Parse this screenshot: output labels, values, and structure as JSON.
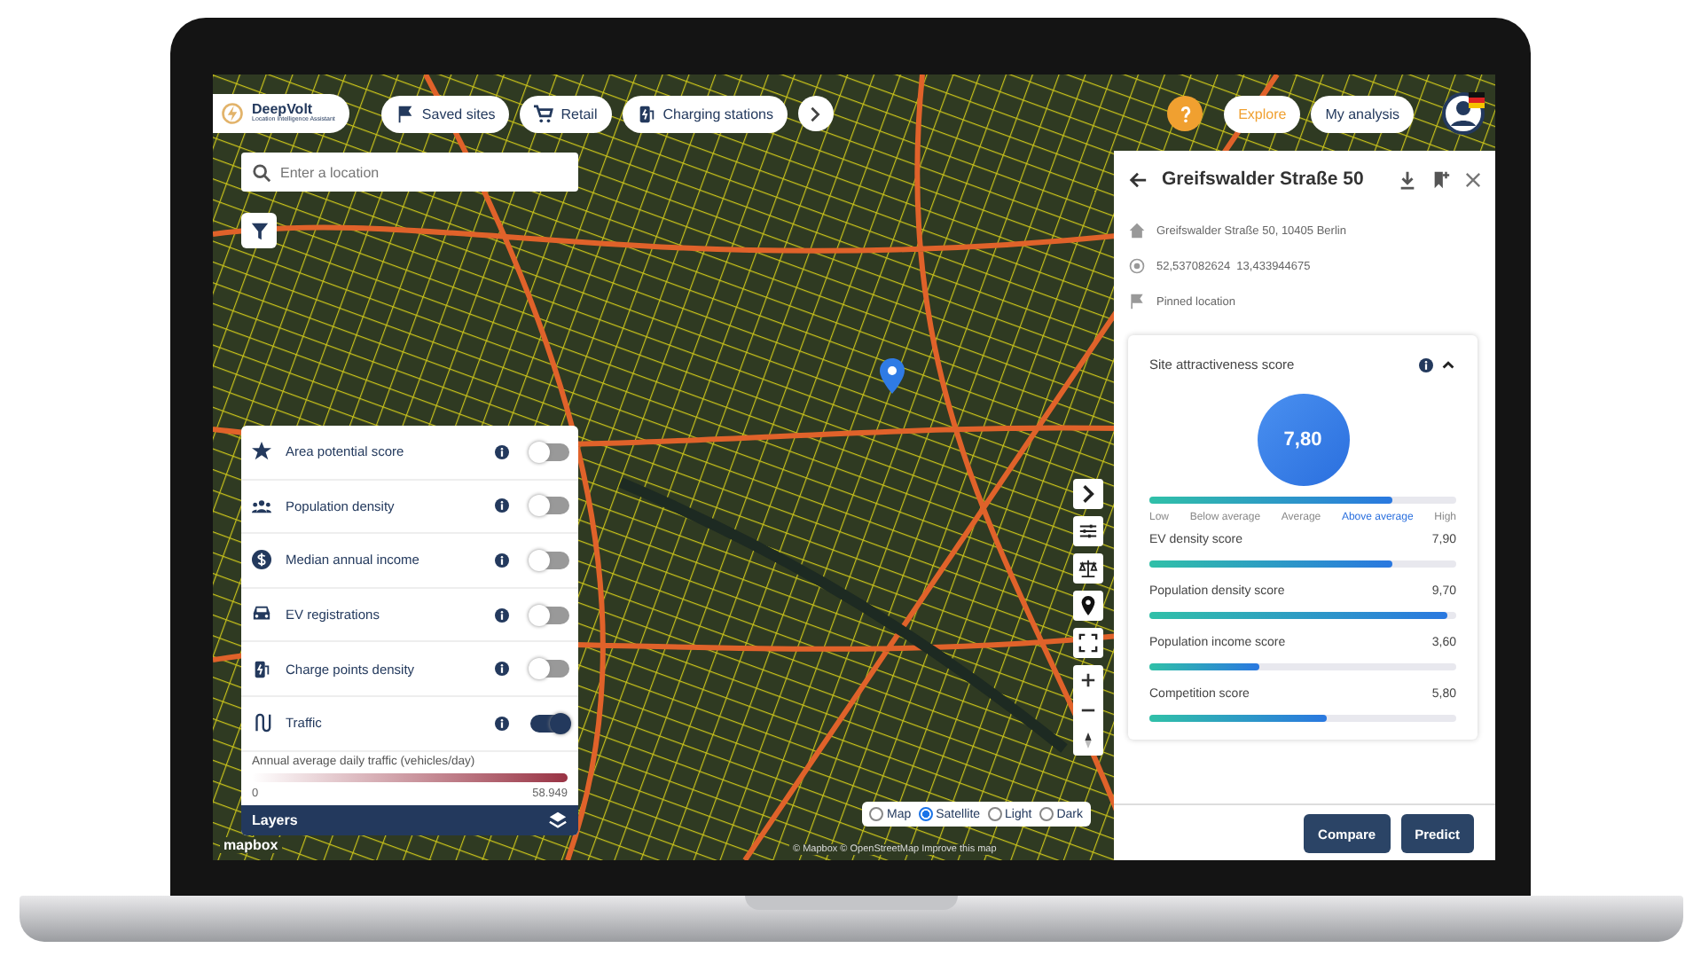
{
  "header": {
    "logo_title": "DeepVolt",
    "logo_subtitle": "Location Intelligence Assistant"
  },
  "nav_chips": [
    {
      "label": "Saved sites",
      "kind": "flag"
    },
    {
      "label": "Retail",
      "kind": "cart"
    },
    {
      "label": "Charging stations",
      "kind": "charger"
    }
  ],
  "mode_buttons": [
    {
      "label": "Explore",
      "selected": true
    },
    {
      "label": "My analysis",
      "selected": false
    }
  ],
  "search": {
    "placeholder": "Enter a location"
  },
  "layers": {
    "items": [
      {
        "label": "Area potential score",
        "kind": "star",
        "on": false
      },
      {
        "label": "Population density",
        "kind": "people",
        "on": false
      },
      {
        "label": "Median annual income",
        "kind": "dollar",
        "on": false
      },
      {
        "label": "EV registrations",
        "kind": "car",
        "on": false
      },
      {
        "label": "Charge points density",
        "kind": "charger",
        "on": false
      },
      {
        "label": "Traffic",
        "kind": "traffic",
        "on": true
      }
    ],
    "legend": {
      "title": "Annual average daily traffic (vehicles/day)",
      "min": "0",
      "max": "58.949"
    },
    "footer": "Layers"
  },
  "map_styles": [
    {
      "label": "Map",
      "selected": false
    },
    {
      "label": "Satellite",
      "selected": true
    },
    {
      "label": "Light",
      "selected": false
    },
    {
      "label": "Dark",
      "selected": false
    }
  ],
  "map_logo": "mapbox",
  "map_attribution": "© Mapbox © OpenStreetMap Improve this map",
  "panel": {
    "title": "Greifswalder Straße 50",
    "address": "Greifswalder Straße 50, 10405 Berlin",
    "coordinates": "52,537082624  13,433944675",
    "pin_label": "Pinned location",
    "score_card": {
      "title": "Site attractiveness score",
      "expanded": true,
      "value": "7,80",
      "level": 0.79,
      "scale": [
        {
          "label": "Low",
          "selected": false
        },
        {
          "label": "Below average",
          "selected": false
        },
        {
          "label": "Average",
          "selected": false
        },
        {
          "label": "Above average",
          "selected": true
        },
        {
          "label": "High",
          "selected": false
        }
      ]
    },
    "scores": [
      {
        "name": "EV density score",
        "value": "7,90",
        "level": 0.79
      },
      {
        "name": "Population density score",
        "value": "9,70",
        "level": 0.97
      },
      {
        "name": "Population income score",
        "value": "3,60",
        "level": 0.36
      },
      {
        "name": "Competition score",
        "value": "5,80",
        "level": 0.58
      }
    ],
    "buttons": [
      "Compare",
      "Predict"
    ]
  }
}
